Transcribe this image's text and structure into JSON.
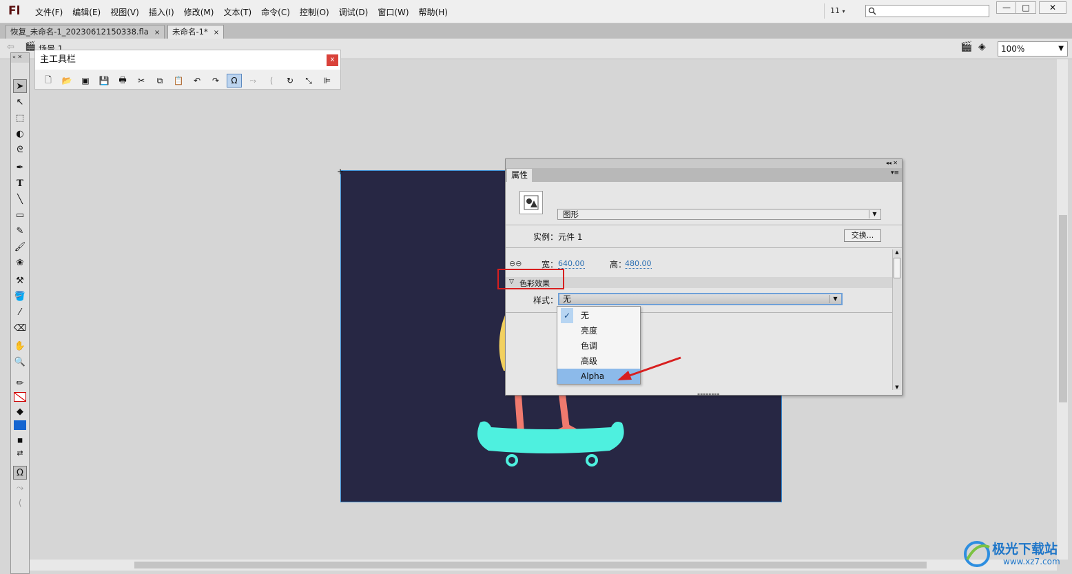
{
  "app": {
    "logo": "Fl",
    "menus": [
      "文件(F)",
      "编辑(E)",
      "视图(V)",
      "插入(I)",
      "修改(M)",
      "文本(T)",
      "命令(C)",
      "控制(O)",
      "调试(D)",
      "窗口(W)",
      "帮助(H)"
    ],
    "workspace_num": "11",
    "window_controls": [
      "—",
      "□",
      "✕"
    ]
  },
  "tabs": [
    {
      "label": "恢复_未命名-1_20230612150338.fla",
      "close": "×"
    },
    {
      "label": "未命名-1*",
      "close": "×"
    }
  ],
  "editbar": {
    "scene": "场景 1",
    "zoom": "100%"
  },
  "main_toolbar": {
    "title": "主工具栏",
    "close": "x"
  },
  "properties": {
    "tab": "属性",
    "type": "图形",
    "instance_label": "实例：",
    "instance_name": "元件 1",
    "swap_button": "交换...",
    "width_label": "宽：",
    "width_value": "640.00",
    "height_label": "高：",
    "height_value": "480.00",
    "color_effect_label": "色彩效果",
    "style_label": "样式：",
    "style_value": "无"
  },
  "style_options": [
    {
      "label": "无",
      "checked": true
    },
    {
      "label": "亮度",
      "checked": false
    },
    {
      "label": "色调",
      "checked": false
    },
    {
      "label": "高级",
      "checked": false
    },
    {
      "label": "Alpha",
      "checked": false,
      "highlighted": true
    }
  ],
  "stage": {
    "background": "#272744",
    "skateboard_color": "#4ef0df",
    "legs_color": "#f07a6e",
    "body_color": "#f2d160"
  },
  "annotation": {
    "color": "#d81f1f"
  },
  "watermark": {
    "name": "极光下载站",
    "url": "www.xz7.com"
  }
}
